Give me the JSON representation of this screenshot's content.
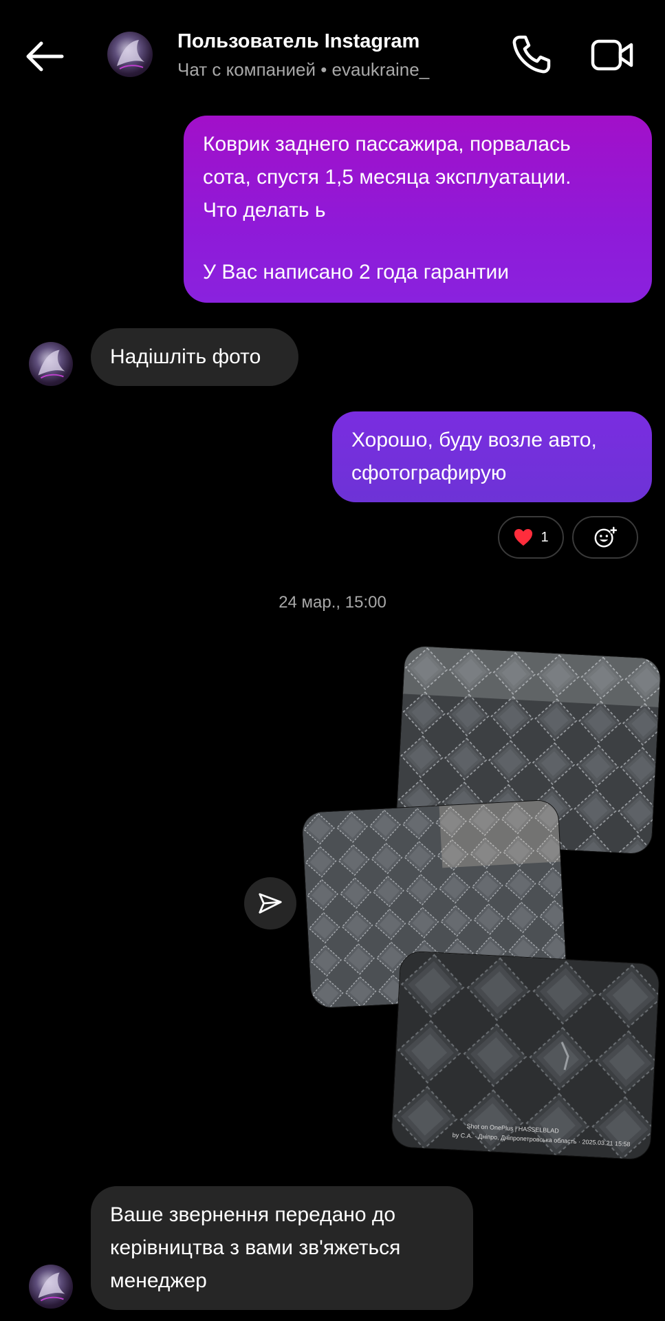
{
  "header": {
    "title": "Пользователь Instagram",
    "subtitle": "Чат с компанией • evaukraine_"
  },
  "messages": {
    "m1_line1": "Коврик заднего пассажира, порвалась",
    "m1_line2": "сота, спустя 1,5 месяца эксплуатации.",
    "m1_line3": "Что делать ь",
    "m1_line4": "У Вас написано 2 года гарантии",
    "m2": "Надішліть фото",
    "m3_line1": "Хорошо, буду возле авто,",
    "m3_line2": "сфотографирую",
    "m5_line1": "Ваше звернення передано до",
    "m5_line2": "керівництва з вами зв'яжеться",
    "m5_line3": "менеджер"
  },
  "reactions": {
    "heart_count": "1"
  },
  "timestamp": "24 мар., 15:00",
  "photo_watermark": {
    "line1": "Shot on OnePlus | HASSELBLAD",
    "line2": "by C.A. · Дніпро, Дніпропетровська область · 2025.03.21 15:58"
  },
  "icons": {
    "back": "arrow-left-icon",
    "call": "phone-icon",
    "video": "video-camera-icon",
    "reaction": "heart-icon",
    "add_reaction": "add-reaction-icon",
    "share": "paper-plane-icon"
  },
  "colors": {
    "background": "#000000",
    "outgoing_bubble_top": "#a210c9",
    "outgoing_bubble_bottom": "#6d33d6",
    "incoming_bubble": "#262626",
    "secondary_text": "#a8a8a8",
    "heart": "#ff2d3c"
  }
}
